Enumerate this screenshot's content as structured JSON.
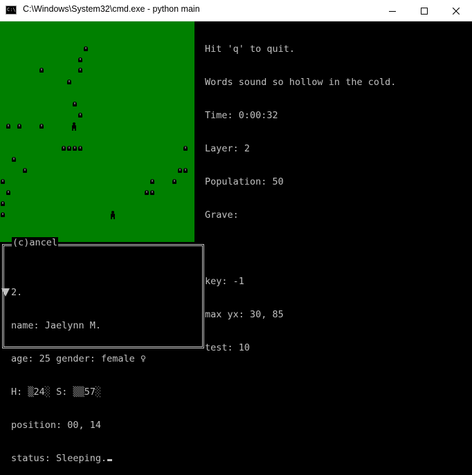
{
  "window": {
    "title": "C:\\Windows\\System32\\cmd.exe - python  main",
    "icon": "cmd-console-icon",
    "icon_text": "C:\\"
  },
  "colors": {
    "map_green": "#008000",
    "terminal_bg": "#000000",
    "terminal_text": "#c0c0c0"
  },
  "info": {
    "quit_hint": "Hit 'q' to quit.",
    "message": "Words sound so hollow in the cold.",
    "time": "Time: 0:00:32",
    "layer": "Layer: 2",
    "population": "Population: 50",
    "grave": "Grave:",
    "key": "key: -1",
    "max_yx": "max yx: 30, 85",
    "test": "test: 10"
  },
  "panel": {
    "title": "(c)ancel",
    "index": "2.",
    "name": "name: Jaelynn M.",
    "age_gender": "age: 25 gender: female ♀",
    "stats_h_label": "H: ",
    "stats_h_shade_a": "▒",
    "stats_h_value": "24",
    "stats_h_shade_b": "░",
    "stats_s_label": " S: ",
    "stats_s_shade_a": "▒▒",
    "stats_s_value": "57",
    "stats_s_shade_b": "░",
    "position": "position: 00, 14",
    "status": "status: Sleeping."
  }
}
